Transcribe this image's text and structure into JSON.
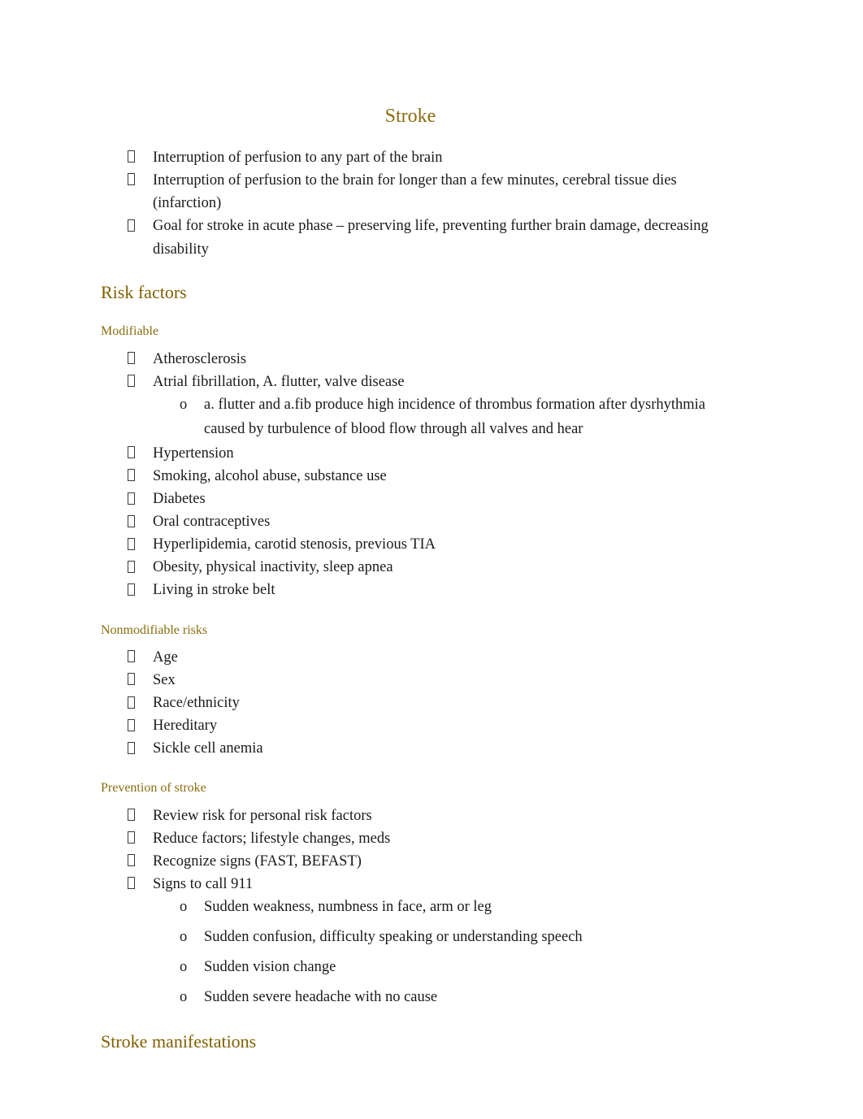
{
  "document": {
    "title": "Stroke",
    "title_color": "#8a6d0f",
    "heading_color": "#806000",
    "subheading_color": "#8a6d0f",
    "body_color": "#1a1a1a",
    "background_color": "#ffffff",
    "bullet_glyph": "missing-glyph-box",
    "sub_bullet_glyph": "o"
  },
  "intro": {
    "items": [
      "Interruption of perfusion to any part of the brain",
      "Interruption of perfusion to the brain for longer than a few minutes, cerebral tissue dies (infarction)",
      "Goal for stroke in acute phase – preserving life, preventing further brain damage, decreasing disability"
    ]
  },
  "sections": {
    "risk_factors": {
      "heading": "Risk factors",
      "modifiable": {
        "heading": "Modifiable",
        "items": [
          "Atherosclerosis",
          "Atrial fibrillation, A. flutter, valve disease",
          "Hypertension",
          "Smoking, alcohol abuse, substance use",
          "Diabetes",
          "Oral contraceptives",
          "Hyperlipidemia, carotid stenosis, previous TIA",
          "Obesity, physical inactivity, sleep apnea",
          "Living in stroke belt"
        ],
        "afib_sub_items": [
          "a. flutter and a.fib produce high incidence of thrombus formation after dysrhythmia caused by turbulence of blood flow through all valves and hear"
        ]
      },
      "nonmodifiable": {
        "heading": "Nonmodifiable risks",
        "items": [
          "Age",
          "Sex",
          "Race/ethnicity",
          "Hereditary",
          "Sickle cell anemia"
        ]
      },
      "prevention": {
        "heading": "Prevention of stroke",
        "items": [
          "Review risk for personal risk factors",
          "Reduce factors; lifestyle changes, meds",
          "Recognize signs (FAST, BEFAST)",
          "Signs to call 911"
        ],
        "call_911_signs": [
          "Sudden weakness, numbness in face, arm or leg",
          "Sudden confusion, difficulty speaking or understanding speech",
          "Sudden vision change",
          "Sudden severe headache with no cause"
        ]
      }
    },
    "manifestations": {
      "heading": "Stroke manifestations"
    }
  }
}
